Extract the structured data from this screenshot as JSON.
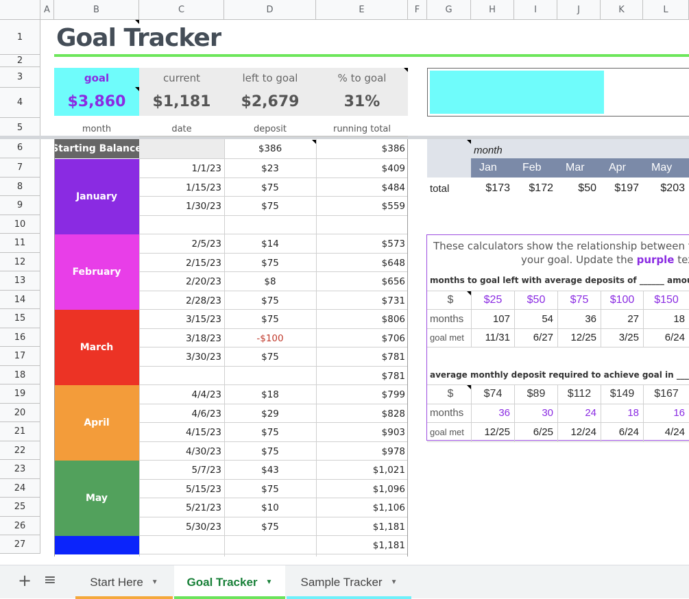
{
  "columns": [
    "A",
    "B",
    "C",
    "D",
    "E",
    "F",
    "G",
    "H",
    "I",
    "J",
    "K",
    "L"
  ],
  "rows": [
    "1",
    "2",
    "3",
    "4",
    "5",
    "6",
    "7",
    "8",
    "9",
    "10",
    "11",
    "12",
    "13",
    "14",
    "15",
    "16",
    "17",
    "18",
    "19",
    "20",
    "21",
    "22",
    "23",
    "24",
    "25",
    "26",
    "27"
  ],
  "title": "Goal Tracker",
  "summary": {
    "goal_label": "goal",
    "goal_value": "$3,860",
    "current_label": "current",
    "current_value": "$1,181",
    "left_label": "left to goal",
    "left_value": "$2,679",
    "pct_label": "% to goal",
    "pct_value": "31%"
  },
  "progress": {
    "fraction": 0.31,
    "color": "#6ffcfb"
  },
  "table_headers": {
    "month": "month",
    "date": "date",
    "deposit": "deposit",
    "running": "running total"
  },
  "starting_balance": {
    "label": "Starting Balance",
    "deposit": "$386",
    "running": "$386"
  },
  "month_blocks": [
    {
      "name": "January",
      "color": "#8a2be2"
    },
    {
      "name": "February",
      "color": "#e83ee8"
    },
    {
      "name": "March",
      "color": "#ec3325"
    },
    {
      "name": "April",
      "color": "#f39c3a"
    },
    {
      "name": "May",
      "color": "#52a15c"
    },
    {
      "name": "",
      "color": "#0b24fb"
    }
  ],
  "entries": [
    {
      "date": "1/1/23",
      "deposit": "$23",
      "running": "$409"
    },
    {
      "date": "1/15/23",
      "deposit": "$75",
      "running": "$484"
    },
    {
      "date": "1/30/23",
      "deposit": "$75",
      "running": "$559"
    },
    {
      "date": "",
      "deposit": "",
      "running": ""
    },
    {
      "date": "2/5/23",
      "deposit": "$14",
      "running": "$573"
    },
    {
      "date": "2/15/23",
      "deposit": "$75",
      "running": "$648"
    },
    {
      "date": "2/20/23",
      "deposit": "$8",
      "running": "$656"
    },
    {
      "date": "2/28/23",
      "deposit": "$75",
      "running": "$731"
    },
    {
      "date": "3/15/23",
      "deposit": "$75",
      "running": "$806"
    },
    {
      "date": "3/18/23",
      "deposit": "-$100",
      "running": "$706"
    },
    {
      "date": "3/30/23",
      "deposit": "$75",
      "running": "$781"
    },
    {
      "date": "",
      "deposit": "",
      "running": "$781"
    },
    {
      "date": "4/4/23",
      "deposit": "$18",
      "running": "$799"
    },
    {
      "date": "4/6/23",
      "deposit": "$29",
      "running": "$828"
    },
    {
      "date": "4/15/23",
      "deposit": "$75",
      "running": "$903"
    },
    {
      "date": "4/30/23",
      "deposit": "$75",
      "running": "$978"
    },
    {
      "date": "5/7/23",
      "deposit": "$43",
      "running": "$1,021"
    },
    {
      "date": "5/15/23",
      "deposit": "$75",
      "running": "$1,096"
    },
    {
      "date": "5/21/23",
      "deposit": "$10",
      "running": "$1,106"
    },
    {
      "date": "5/30/23",
      "deposit": "$75",
      "running": "$1,181"
    },
    {
      "date": "",
      "deposit": "",
      "running": "$1,181"
    }
  ],
  "monthly_totals": {
    "header": "month",
    "row_label": "total",
    "months": [
      "Jan",
      "Feb",
      "Mar",
      "Apr",
      "May"
    ],
    "totals": [
      "$173",
      "$172",
      "$50",
      "$197",
      "$203"
    ]
  },
  "calculator": {
    "intro_line1": "These calculators show the relationship between the",
    "intro_line2_pre": "your goal. Update the",
    "intro_purple": "purple",
    "intro_line2_post": "text t",
    "sec1_label": "months to goal left with average deposits of ______ amount",
    "sec1_header_label": "$",
    "sec1_amounts": [
      "$25",
      "$50",
      "$75",
      "$100",
      "$150"
    ],
    "sec1_months_label": "months",
    "sec1_months": [
      "107",
      "54",
      "36",
      "27",
      "18"
    ],
    "sec1_goalmet_label": "goal met",
    "sec1_goalmet": [
      "11/31",
      "6/27",
      "12/25",
      "3/25",
      "6/24"
    ],
    "sec2_label": "average monthly deposit required to achieve goal in _____ mo",
    "sec2_header_label": "$",
    "sec2_amounts": [
      "$74",
      "$89",
      "$112",
      "$149",
      "$167"
    ],
    "sec2_months_label": "months",
    "sec2_months": [
      "36",
      "30",
      "24",
      "18",
      "16"
    ],
    "sec2_goalmet_label": "goal met",
    "sec2_goalmet": [
      "12/25",
      "6/25",
      "12/24",
      "6/24",
      "4/24"
    ]
  },
  "toolbar": {
    "add": "+",
    "menu": "≡"
  },
  "sheet_tabs": [
    {
      "label": "Start Here",
      "color": "#f4a83b",
      "active": false
    },
    {
      "label": "Goal Tracker",
      "color": "#6be35b",
      "active": true
    },
    {
      "label": "Sample Tracker",
      "color": "#6ff0fa",
      "active": false
    }
  ]
}
